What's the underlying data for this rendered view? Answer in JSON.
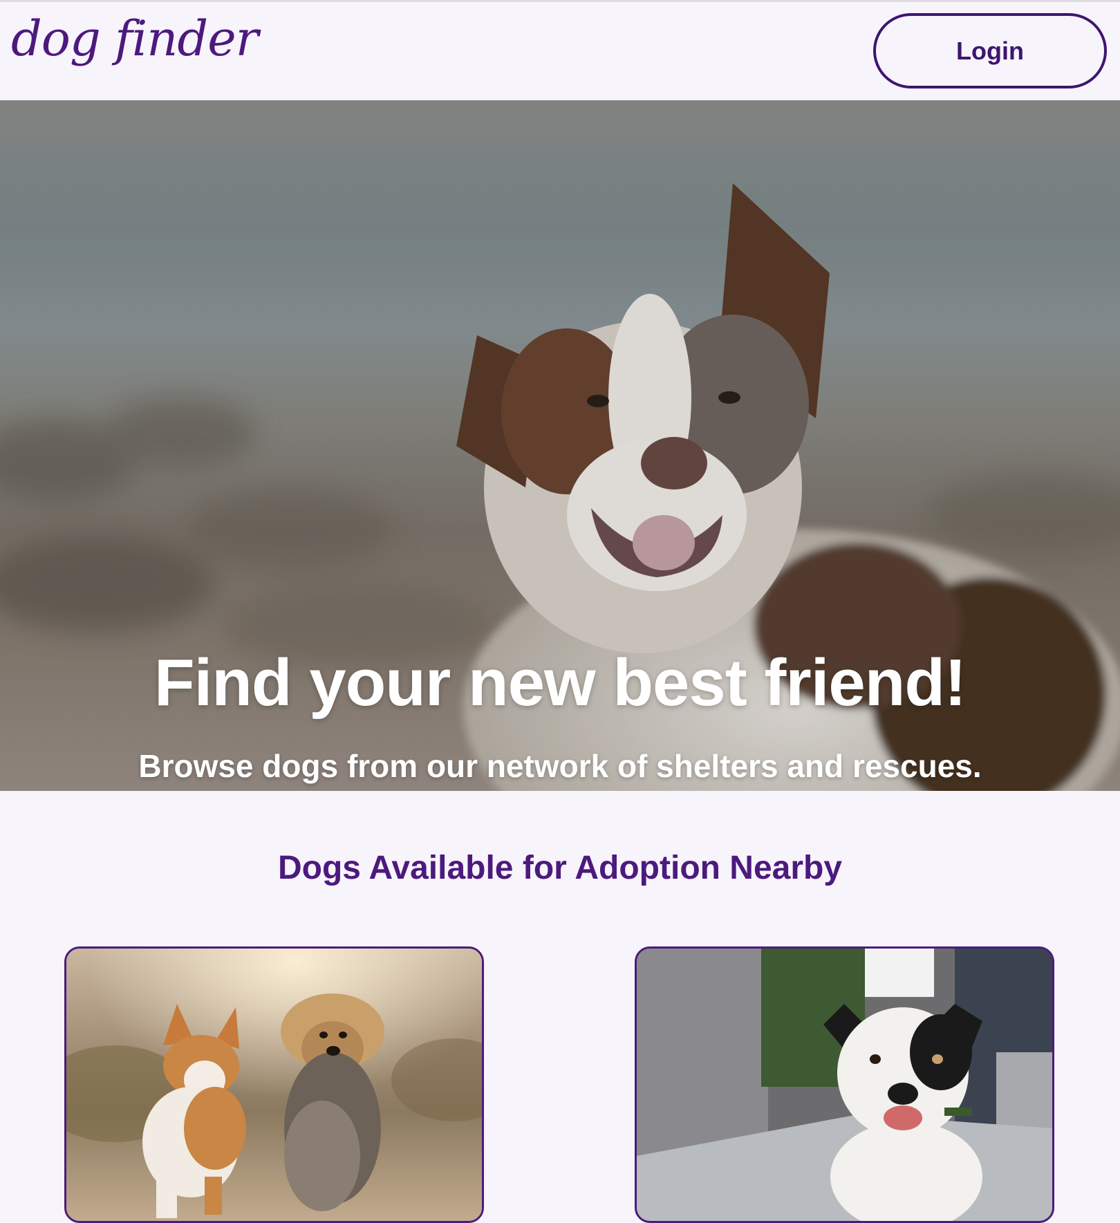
{
  "header": {
    "logo_text": "dog finder",
    "login_label": "Login"
  },
  "hero": {
    "title": "Find your new best friend!",
    "subtitle": "Browse dogs from our network of shelters and rescues."
  },
  "listings": {
    "title": "Dogs Available for Adoption Nearby"
  },
  "colors": {
    "brand_purple": "#4c1a7d",
    "background": "#f8f4fc"
  }
}
